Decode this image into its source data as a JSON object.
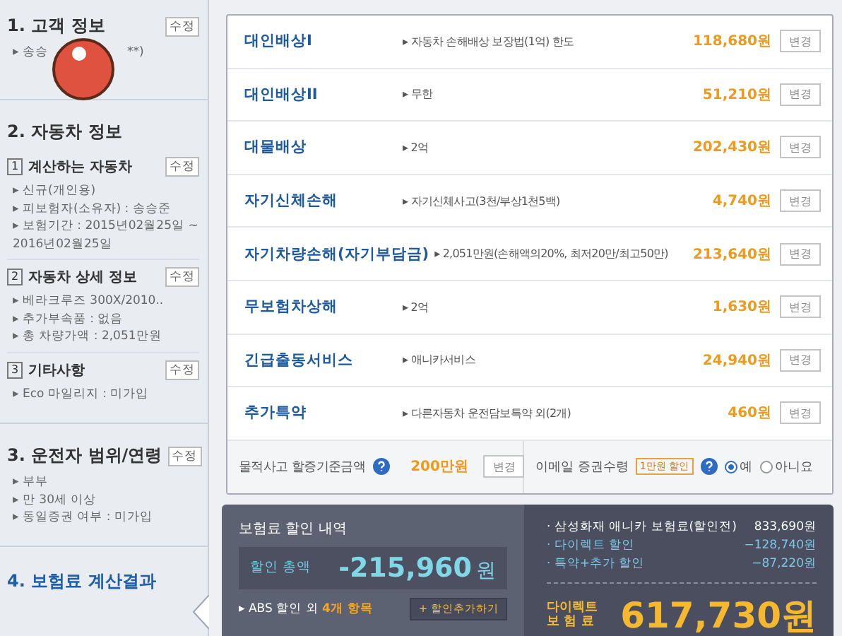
{
  "sidebar": {
    "sections": [
      {
        "title": "1. 고객 정보",
        "edit": "수정",
        "selected": false,
        "items": [
          "▸ 송승",
          "**)"
        ]
      },
      {
        "title": "2. 자동차 정보",
        "selected": false,
        "subsections": [
          {
            "num": "1",
            "title": "계산하는 자동차",
            "edit": "수정",
            "items": [
              "▸ 신규(개인용)",
              "▸ 피보험자(소유자) : 송승준",
              "▸ 보험기간 : 2015년02월25일 ~ 2016년02월25일"
            ]
          },
          {
            "num": "2",
            "title": "자동차 상세 정보",
            "edit": "수정",
            "items": [
              "▸ 베라크루즈 300X/2010..",
              "▸ 추가부속품 : 없음",
              "▸ 총 차량가액 : 2,051만원"
            ]
          },
          {
            "num": "3",
            "title": "기타사항",
            "edit": "수정",
            "items": [
              "▸ Eco 마일리지 : 미가입"
            ]
          }
        ]
      },
      {
        "title": "3. 운전자 범위/연령",
        "edit": "수정",
        "selected": false,
        "items": [
          "▸ 부부",
          "▸ 만 30세 이상",
          "▸ 동일증권 여부 : 미가입"
        ]
      },
      {
        "title": "4. 보험료 계산결과",
        "selected": true
      }
    ]
  },
  "coverages": [
    {
      "name": "대인배상I",
      "detail": "▸ 자동차 손해배상 보장법(1억) 한도",
      "amount": "118,680원",
      "button": "변경"
    },
    {
      "name": "대인배상II",
      "detail": "▸ 무한",
      "amount": "51,210원",
      "button": "변경"
    },
    {
      "name": "대물배상",
      "detail": "▸ 2억",
      "amount": "202,430원",
      "button": "변경"
    },
    {
      "name": "자기신체손해",
      "detail": "▸ 자기신체사고(3천/부상1천5백)",
      "amount": "4,740원",
      "button": "변경"
    },
    {
      "name": "자기차량손해(자기부담금)",
      "detail": "▸ 2,051만원(손해액의20%, 최저20만/최고50만)",
      "amount": "213,640원",
      "button": "변경"
    },
    {
      "name": "무보험차상해",
      "detail": "▸ 2억",
      "amount": "1,630원",
      "button": "변경"
    },
    {
      "name": "긴급출동서비스",
      "detail": "▸ 애니카서비스",
      "amount": "24,940원",
      "button": "변경"
    },
    {
      "name": "추가특약",
      "detail": "▸ 다른자동차 운전담보특약 외(2개)",
      "amount": "460원",
      "button": "변경"
    }
  ],
  "options": {
    "threshold_label": "물적사고 할증기준금액",
    "threshold_amount": "200만원",
    "threshold_button": "변경",
    "email_label": "이메일 증권수령",
    "email_badge": "1만원 할인",
    "radios": [
      {
        "label": "예",
        "selected": true
      },
      {
        "label": "아니요",
        "selected": false
      }
    ]
  },
  "summary": {
    "title": "보험료 할인 내역",
    "total_label": "할인 총액",
    "total": "-215,960",
    "unit": "원",
    "abs_prefix": "▸ ABS 할인 외",
    "abs_highlight": "4개 항목",
    "add_button": "+ 할인추가하기",
    "lines": [
      {
        "label": "· 삼성화재 애니카 보험료(할인전)",
        "value": "833,690원",
        "kind": "base"
      },
      {
        "label": "· 다이렉트 할인",
        "value": "−128,740원",
        "kind": "discount"
      },
      {
        "label": "· 특약+추가 할인",
        "value": "−87,220원",
        "kind": "discount"
      }
    ],
    "final_label": [
      "다이렉트",
      "보 험 료"
    ],
    "final_amount": "617,730원"
  }
}
